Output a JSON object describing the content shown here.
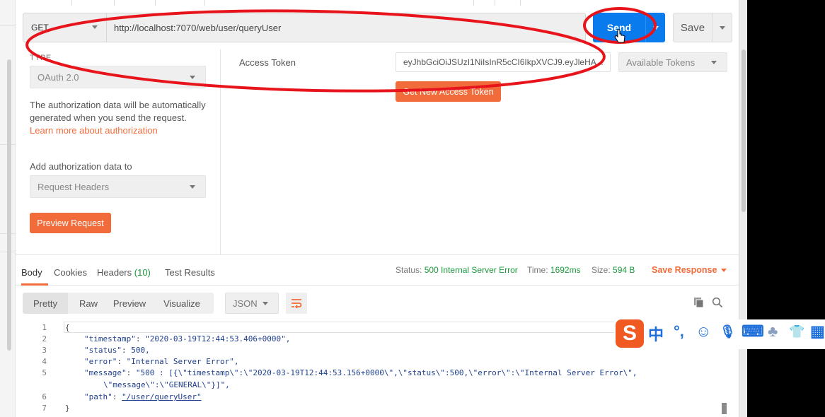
{
  "request": {
    "method": "GET",
    "url": "http://localhost:7070/web/user/queryUser",
    "send_label": "Send",
    "save_label": "Save"
  },
  "auth": {
    "type_label": "TYPE",
    "type_value": "OAuth 2.0",
    "description": "The authorization data will be automatically generated when you send the request.",
    "learn_more": "Learn more about authorization",
    "add_to_label": "Add authorization data to",
    "add_to_value": "Request Headers",
    "preview_button": "Preview Request",
    "access_token_label": "Access Token",
    "access_token_value": "eyJhbGciOiJSUzI1NiIsInR5cCI6IkpXVCJ9.eyJleHA...",
    "available_tokens": "Available Tokens",
    "get_new_token_button": "Get New Access Token"
  },
  "response": {
    "tabs": [
      {
        "label": "Body"
      },
      {
        "label": "Cookies"
      },
      {
        "label": "Headers",
        "count": "(10)"
      },
      {
        "label": "Test Results"
      }
    ],
    "status_label": "Status:",
    "status_value": "500 Internal Server Error",
    "time_label": "Time:",
    "time_value": "1692ms",
    "size_label": "Size:",
    "size_value": "594 B",
    "save_response": "Save Response",
    "formats": [
      "Pretty",
      "Raw",
      "Preview",
      "Visualize"
    ],
    "language": "JSON",
    "icons": [
      "wrap-icon",
      "copy-icon",
      "search-icon"
    ],
    "code_lines": [
      {
        "num": "1",
        "text": "{"
      },
      {
        "num": "2",
        "key": "\"timestamp\"",
        "value": "\"2020-03-19T12:44:53.406+0000\","
      },
      {
        "num": "3",
        "key": "\"status\"",
        "value": "500,"
      },
      {
        "num": "4",
        "key": "\"error\"",
        "value": "\"Internal Server Error\","
      },
      {
        "num": "5",
        "key": "\"message\"",
        "value": "\"500 : [{\\\"timestamp\\\":\\\"2020-03-19T12:44:53.156+0000\\\",\\\"status\\\":500,\\\"error\\\":\\\"Internal Server Error\\\","
      },
      {
        "num": "",
        "text": "\\\"message\\\":\\\"GENERAL\\\"}]\","
      },
      {
        "num": "6",
        "key": "\"path\"",
        "value": "\"/user/queryUser\""
      },
      {
        "num": "7",
        "text": "}"
      }
    ]
  },
  "ime": {
    "logo": "S",
    "glyphs": [
      "中",
      "°,",
      "☺",
      "🎙",
      "⌨",
      "♣",
      "👕",
      "▦"
    ]
  },
  "colors": {
    "accent": "#f26b3a",
    "send_blue": "#097bed",
    "success_green": "#1b9a3b",
    "annotation_red": "#e8141b"
  }
}
